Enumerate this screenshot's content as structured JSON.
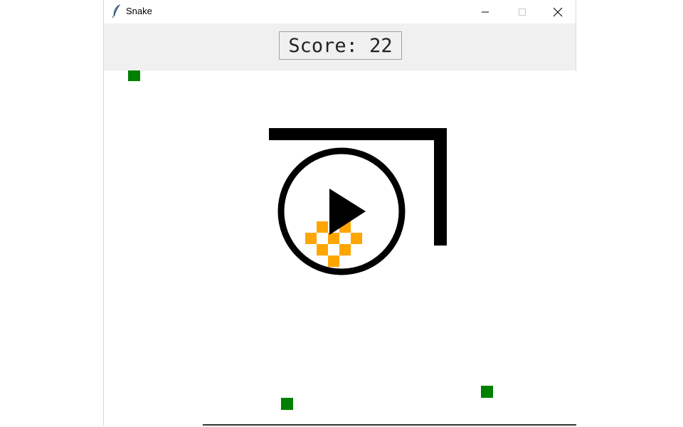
{
  "window": {
    "title": "Snake",
    "controls": {
      "minimize": "minimize-icon",
      "maximize": "maximize-icon",
      "close": "close-icon"
    }
  },
  "score": {
    "text": "Score: 22"
  },
  "colors": {
    "food": "#008000",
    "snake": "#ffa500",
    "wall": "#000000",
    "scorebar_bg": "#f0f0f0",
    "play_overlay": "#000000"
  },
  "overlay": {
    "icon": "play-icon"
  }
}
